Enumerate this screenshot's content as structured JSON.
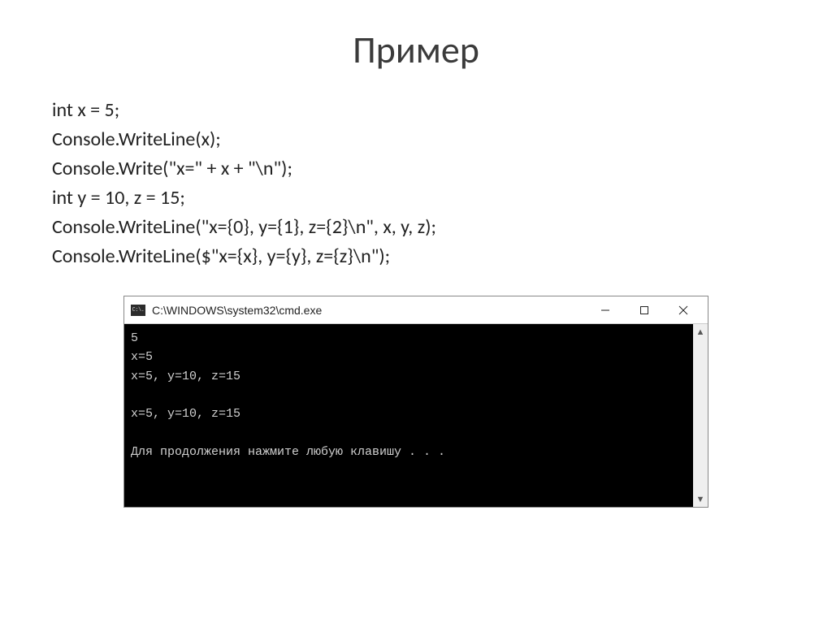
{
  "slide": {
    "title": "Пример"
  },
  "code": {
    "line1": "int x = 5;",
    "line2": "Console.WriteLine(x);",
    "line3": "Console.Write(\"x=\" + x + \"\\n\");",
    "line4": "int y = 10, z = 15;",
    "line5": "Console.WriteLine(\"x={0}, y={1}, z={2}\\n\", x, y, z);",
    "line6": "Console.WriteLine($\"x={x}, y={y}, z={z}\\n\");"
  },
  "window": {
    "title": "C:\\WINDOWS\\system32\\cmd.exe",
    "icon_label": "C:\\.",
    "output": "5\nx=5\nx=5, y=10, z=15\n\nx=5, y=10, z=15\n\nДля продолжения нажмите любую клавишу . . ."
  }
}
